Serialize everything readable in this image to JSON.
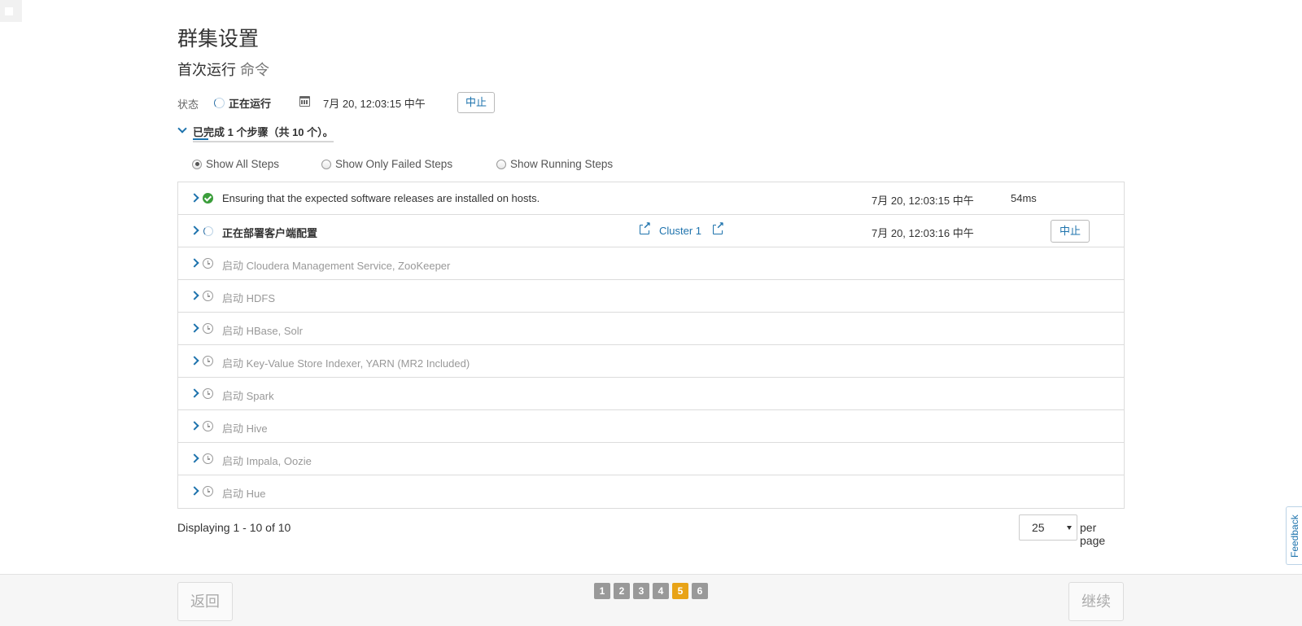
{
  "page": {
    "title": "群集设置",
    "subtitle_main": "首次运行",
    "subtitle_muted": "命令"
  },
  "status": {
    "label": "状态",
    "value": "正在运行",
    "start_time": "7月 20, 12:03:15 中午",
    "abort_label": "中止"
  },
  "summary": {
    "text": "已完成 1 个步骤（共 10 个）。",
    "completed_steps": 1,
    "total_steps": 10
  },
  "filters": [
    {
      "label": "Show All Steps",
      "checked": true
    },
    {
      "label": "Show Only Failed Steps",
      "checked": false
    },
    {
      "label": "Show Running Steps",
      "checked": false
    }
  ],
  "steps": [
    {
      "name": "Ensuring that the expected software releases are installed on hosts.",
      "state": "completed",
      "time": "7月 20, 12:03:15 中午",
      "duration": "54ms"
    },
    {
      "name": "正在部署客户端配置",
      "state": "running",
      "cluster_link": "Cluster 1",
      "time": "7月 20, 12:03:16 中午",
      "abort_label": "中止"
    },
    {
      "name": "启动 Cloudera Management Service, ZooKeeper",
      "state": "pending"
    },
    {
      "name": "启动 HDFS",
      "state": "pending"
    },
    {
      "name": "启动 HBase, Solr",
      "state": "pending"
    },
    {
      "name": "启动 Key-Value Store Indexer, YARN (MR2 Included)",
      "state": "pending"
    },
    {
      "name": "启动 Spark",
      "state": "pending"
    },
    {
      "name": "启动 Hive",
      "state": "pending"
    },
    {
      "name": "启动 Impala, Oozie",
      "state": "pending"
    },
    {
      "name": "启动 Hue",
      "state": "pending"
    }
  ],
  "pagination": {
    "info": "Displaying 1 - 10 of 10",
    "per_page_value": "25",
    "per_page_label": "per page"
  },
  "wizard": {
    "back_label": "返回",
    "continue_label": "继续",
    "steps": [
      "1",
      "2",
      "3",
      "4",
      "5",
      "6"
    ],
    "active_step": "5"
  },
  "feedback_label": "Feedback",
  "colors": {
    "link": "#1e73ad",
    "success": "#3b9e3b",
    "active_wizard_step": "#e8a317",
    "inactive_wizard_step": "#999999"
  },
  "icons": {
    "status": "spinner-icon",
    "date": "calendar-icon",
    "expand": "chevron-right-icon",
    "collapse": "chevron-down-icon",
    "completed": "check-circle-icon",
    "pending": "clock-icon",
    "external_link": "external-link-icon"
  }
}
